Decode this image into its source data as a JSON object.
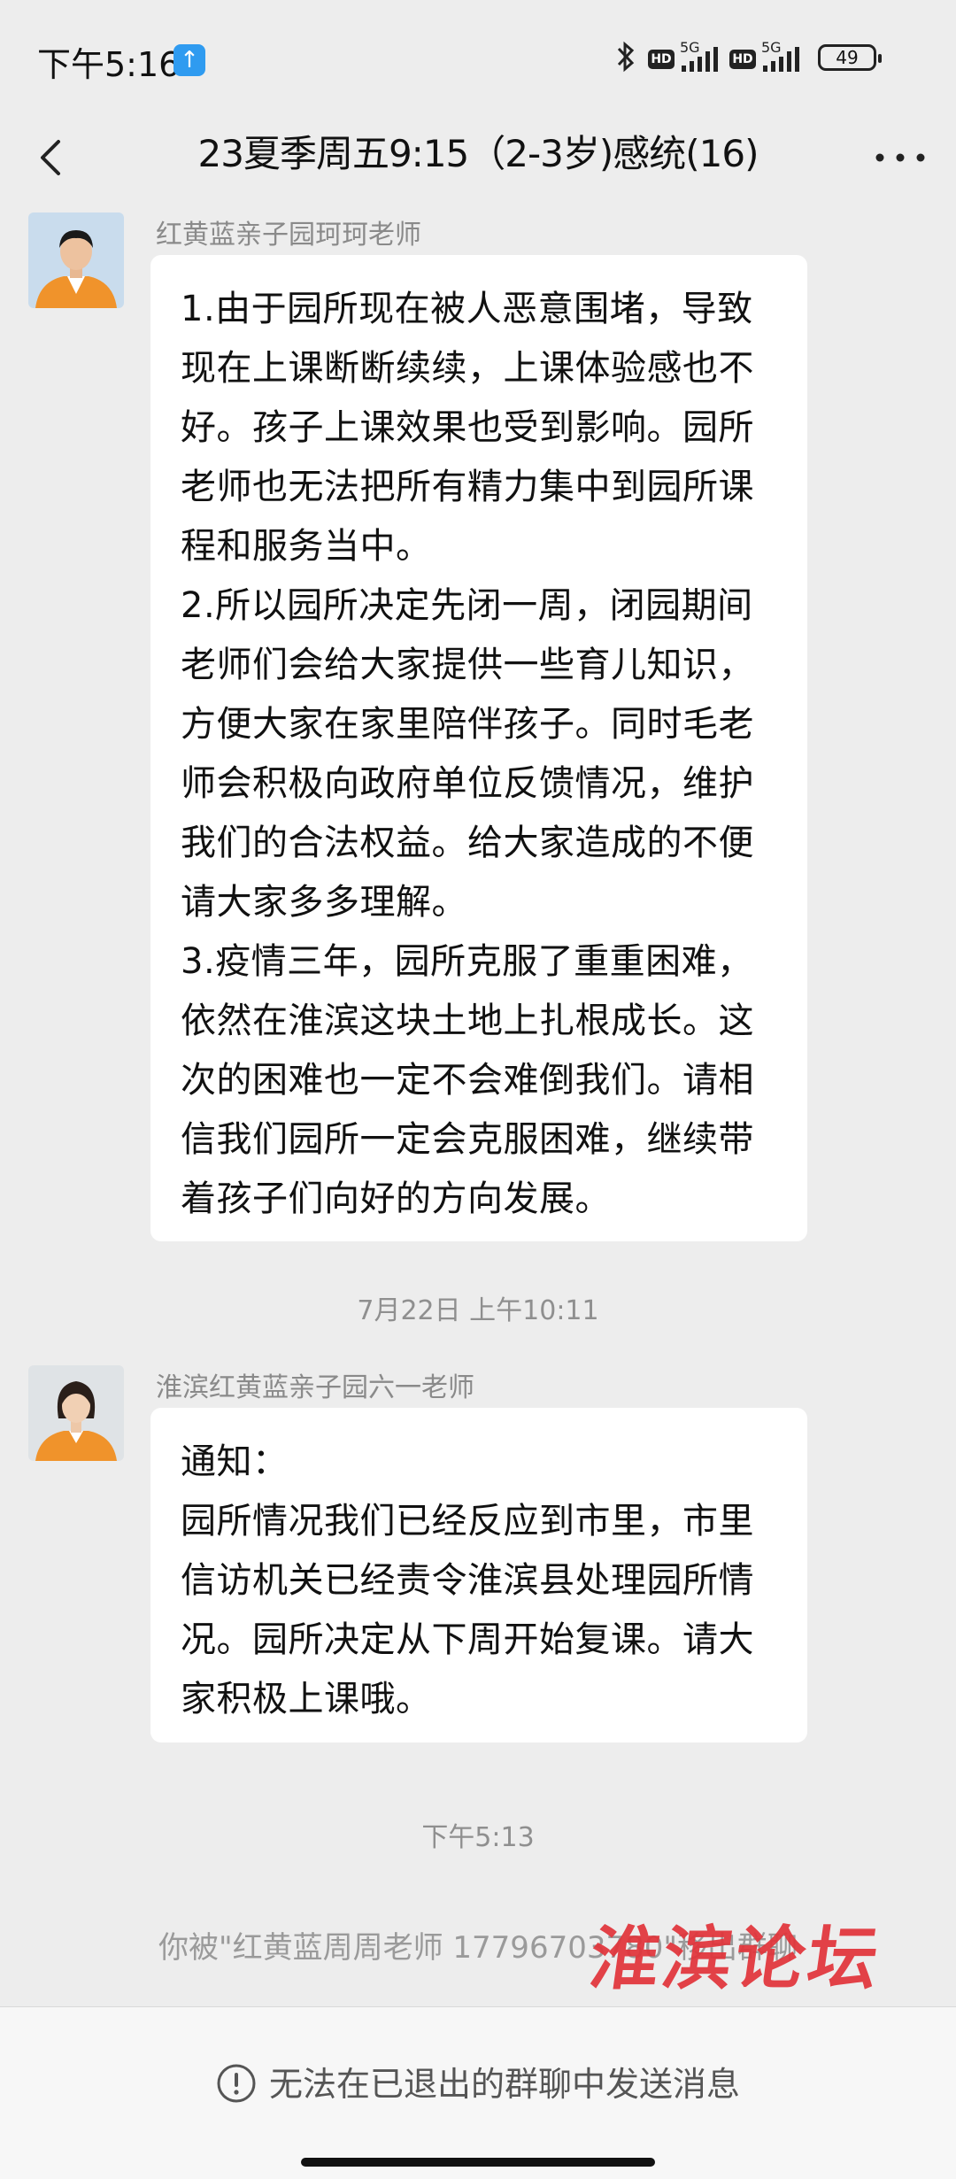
{
  "status_bar": {
    "time": "下午5:16",
    "network_label_1": "5G",
    "network_label_2": "5G",
    "hd_label": "HD",
    "battery": "49"
  },
  "header": {
    "title": "23夏季周五9:15（2-3岁)感统(16)"
  },
  "messages": [
    {
      "sender": "红黄蓝亲子园珂珂老师",
      "text": "1.由于园所现在被人恶意围堵，导致现在上课断断续续，上课体验感也不好。孩子上课效果也受到影响。园所老师也无法把所有精力集中到园所课程和服务当中。\n2.所以园所决定先闭一周，闭园期间老师们会给大家提供一些育儿知识，方便大家在家里陪伴孩子。同时毛老师会积极向政府单位反馈情况，维护我们的合法权益。给大家造成的不便请大家多多理解。\n3.疫情三年，园所克服了重重困难，依然在淮滨这块土地上扎根成长。这次的困难也一定不会难倒我们。请相信我们园所一定会克服困难，继续带着孩子们向好的方向发展。"
    },
    {
      "sender": "淮滨红黄蓝亲子园六一老师",
      "text": "通知：\n园所情况我们已经反应到市里，市里信访机关已经责令淮滨县处理园所情况。园所决定从下周开始复课。请大家积极上课哦。"
    }
  ],
  "timestamps": {
    "t1": "7月22日 上午10:11",
    "t2": "下午5:13"
  },
  "system_note": "你被\"红黄蓝周周老师 17796703780\"移出群聊",
  "watermark_text": "淮滨论坛",
  "bottom_bar": {
    "message": "无法在已退出的群聊中发送消息"
  },
  "icons": [
    "notification-icon",
    "bluetooth-icon",
    "signal-icon",
    "battery-icon",
    "back-icon",
    "more-icon",
    "warning-icon"
  ],
  "colors": {
    "background": "#ededed",
    "bubble": "#ffffff",
    "watermark": "#e2333a",
    "avatar_shirt": "#f0932b"
  }
}
